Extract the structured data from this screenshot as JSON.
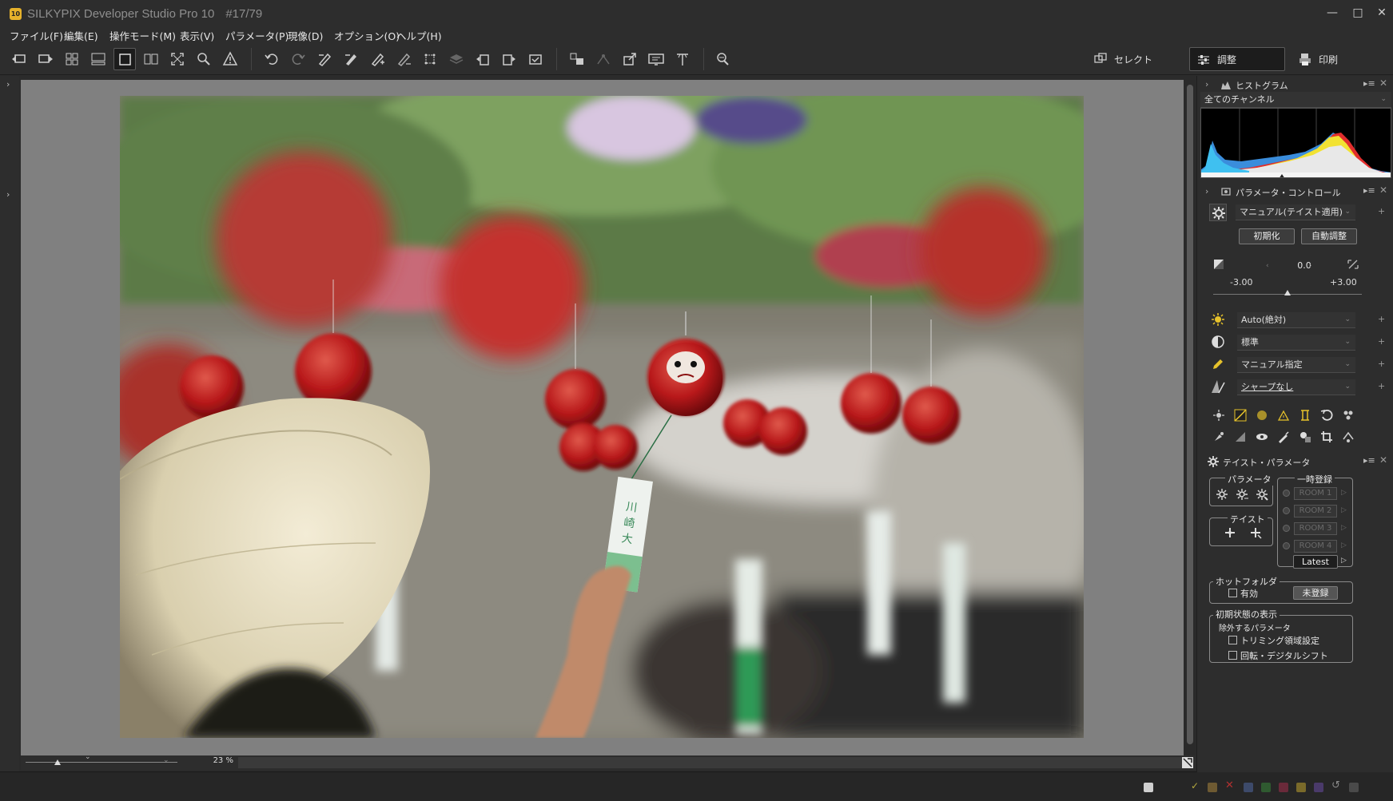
{
  "window": {
    "title": "SILKYPIX Developer Studio Pro 10",
    "counter": "#17/79",
    "logo_text": "10",
    "minimize": "—",
    "maximize": "□",
    "close": "✕"
  },
  "menu": [
    "ファイル(F)",
    "編集(E)",
    "操作モード(M)",
    "表示(V)",
    "パラメータ(P)",
    "現像(D)",
    "オプション(O)",
    "ヘルプ(H)"
  ],
  "modes": {
    "select": "セレクト",
    "adjust": "調整",
    "print": "印刷"
  },
  "viewer": {
    "zoom_value": "23",
    "zoom_unit": "%"
  },
  "panels": {
    "histogram": {
      "title": "ヒストグラム",
      "channel": "全てのチャンネル"
    },
    "parameter_control": {
      "title": "パラメータ・コントロール",
      "taste": "マニュアル(テイスト適用)",
      "reset_button": "初期化",
      "auto_button": "自動調整",
      "exposure_value": "0.0",
      "exposure_min": "-3.00",
      "exposure_max": "+3.00",
      "exposure_level": 0.5,
      "white_balance": "Auto(絶対)",
      "tone": "標準",
      "color": "マニュアル指定",
      "sharpness": "シャープなし"
    },
    "taste_parameter": {
      "title": "テイスト・パラメータ",
      "param_group": "パラメータ",
      "taste_group": "テイスト",
      "temp_group": "一時登録",
      "rooms": [
        "ROOM 1",
        "ROOM 2",
        "ROOM 3",
        "ROOM 4"
      ],
      "latest_button": "Latest",
      "hotfolder_group": "ホットフォルダ",
      "hotfolder_enabled": "有効",
      "hotfolder_button": "未登録",
      "initial_group": "初期状態の表示",
      "exclude_label": "除外するパラメータ",
      "exclude_trim": "トリミング領域設定",
      "exclude_rotate": "回転・デジタルシフト"
    }
  },
  "colors": {
    "accent": "#e6b22b",
    "panel_bg": "#2d2d2d",
    "viewer_bg": "#808080"
  }
}
